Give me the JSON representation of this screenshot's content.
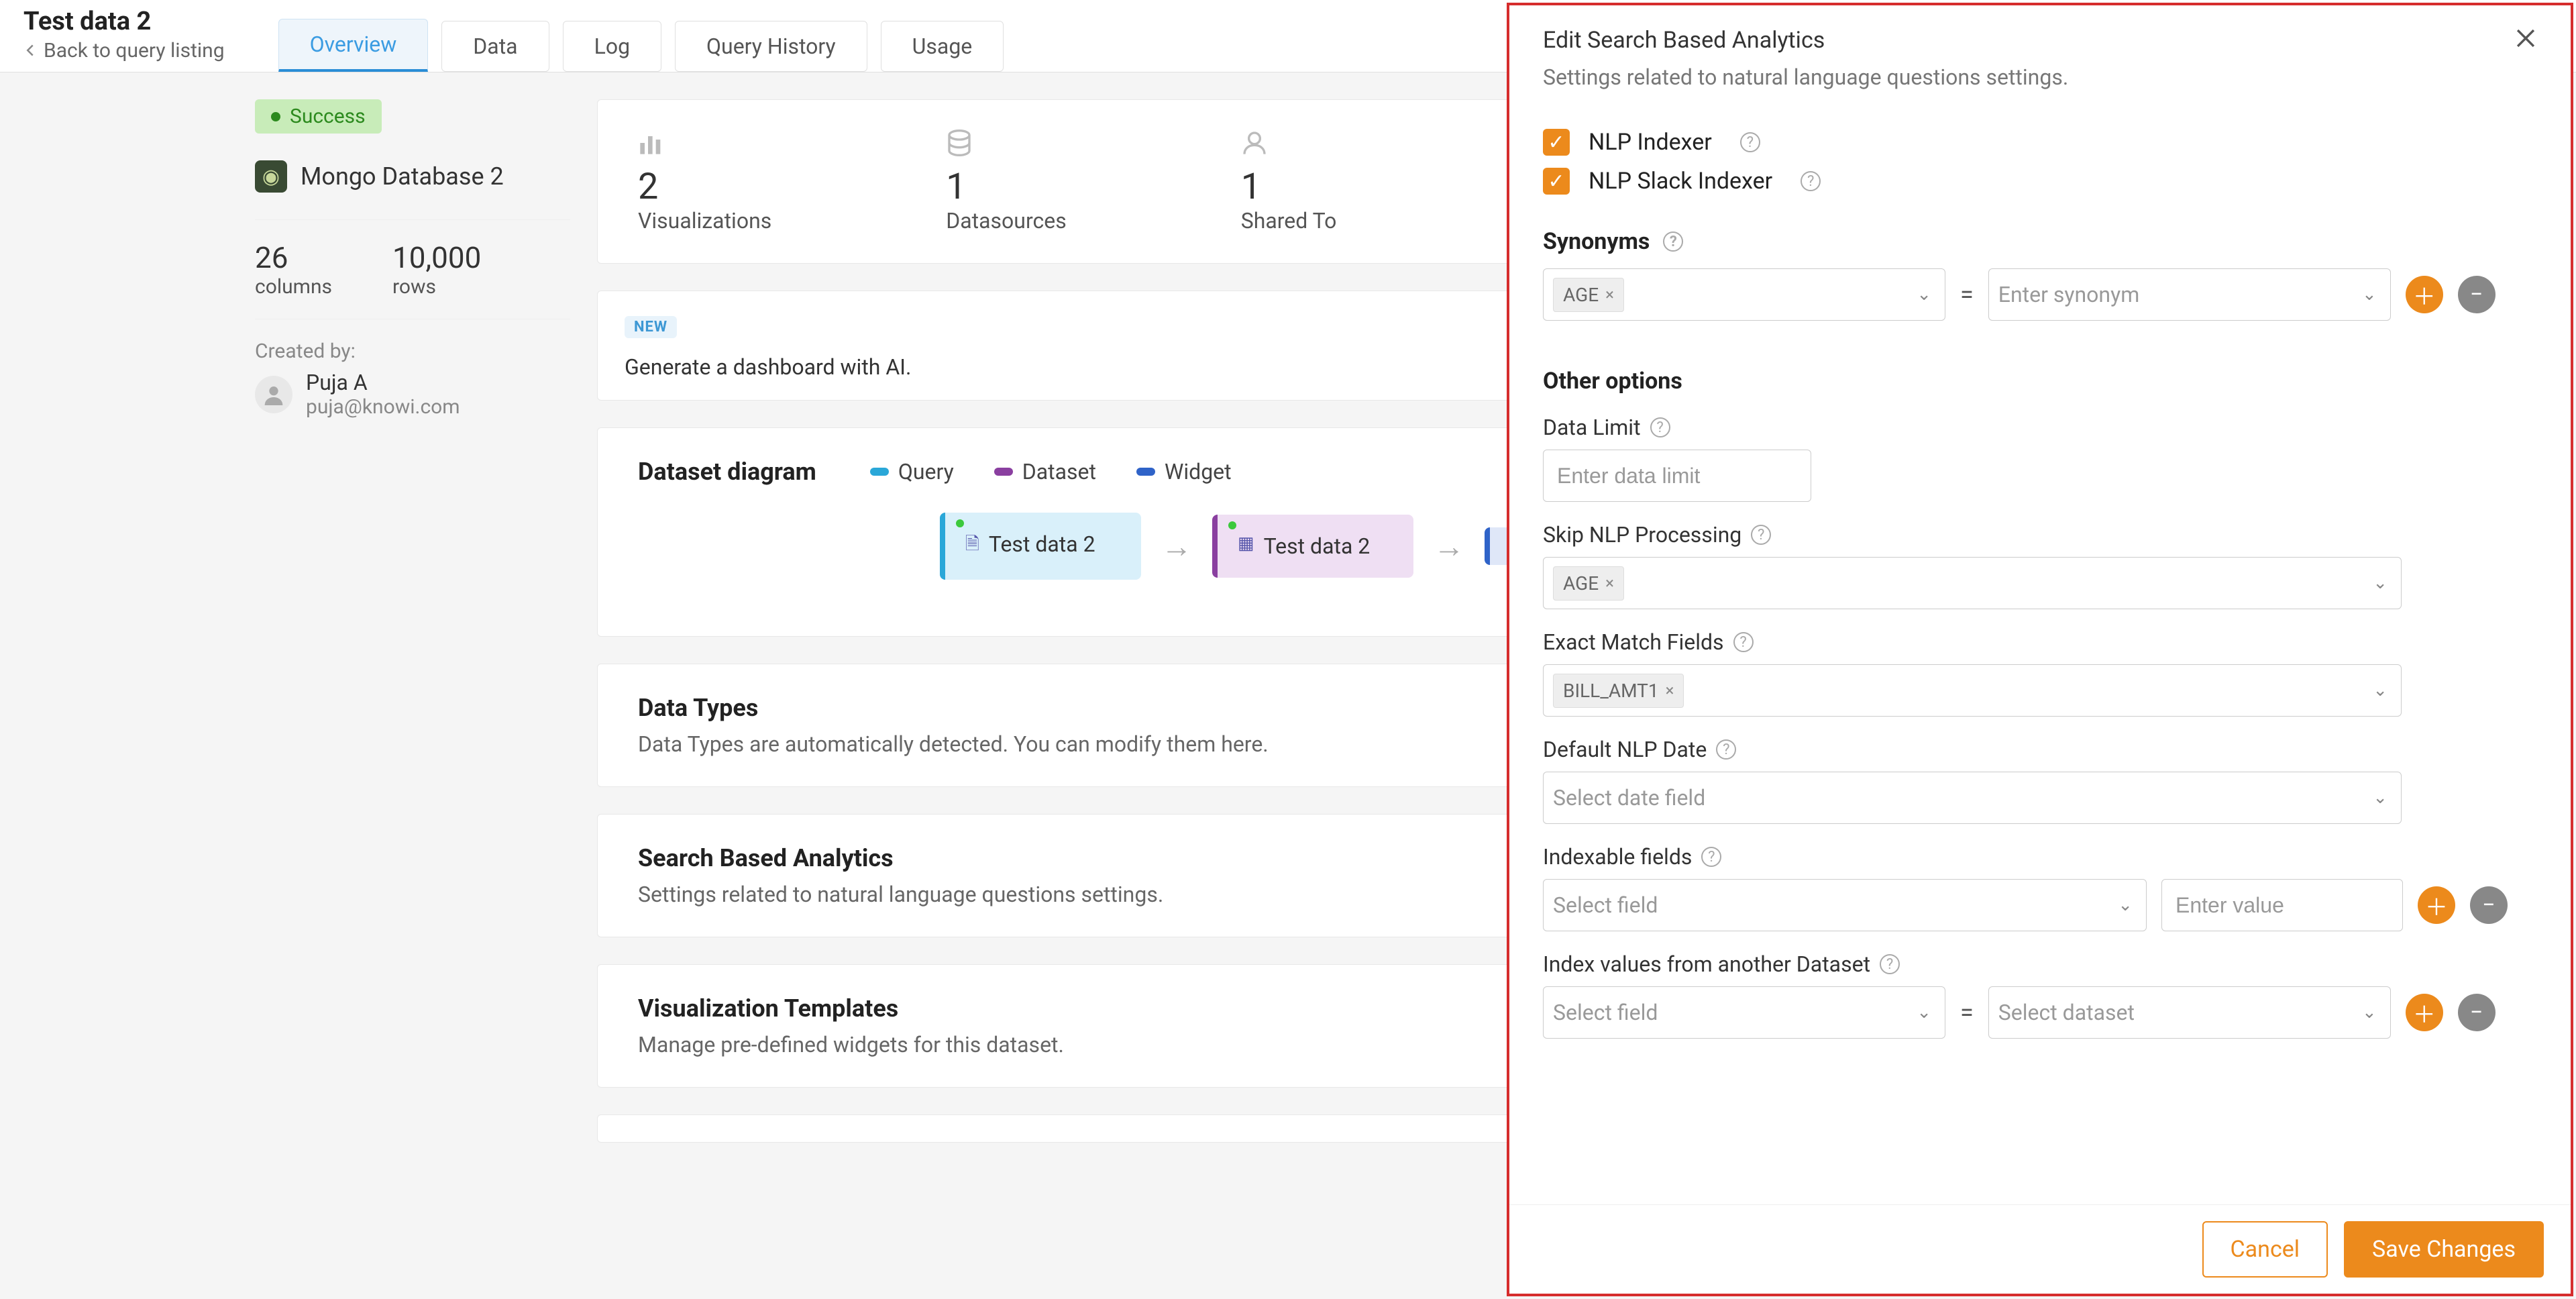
{
  "header": {
    "title": "Test data 2",
    "back_label": "Back to query listing",
    "tabs": [
      "Overview",
      "Data",
      "Log",
      "Query History",
      "Usage"
    ],
    "active_tab": 0
  },
  "left": {
    "status": "Success",
    "datasource_name": "Mongo Database 2",
    "cols_value": "26",
    "cols_label": "columns",
    "rows_value": "10,000",
    "rows_label": "rows",
    "created_by_label": "Created by:",
    "author_name": "Puja A",
    "author_email": "puja@knowi.com"
  },
  "stats": {
    "viz_value": "2",
    "viz_label": "Visualizations",
    "ds_value": "1",
    "ds_label": "Datasources",
    "shared_value": "1",
    "shared_label": "Shared To"
  },
  "gen_card": {
    "new_tag": "NEW",
    "text": "Generate a dashboard with AI."
  },
  "diagram": {
    "title": "Dataset diagram",
    "legend": {
      "query": "Query",
      "dataset": "Dataset",
      "widget": "Widget"
    },
    "node_query": "Test data 2",
    "node_dataset": "Test data 2"
  },
  "dtype_card": {
    "title": "Data Types",
    "sub": "Data Types are automatically detected. You can modify them here."
  },
  "sba_card": {
    "title": "Search Based Analytics",
    "sub": "Settings related to natural language questions settings."
  },
  "vt_card": {
    "title": "Visualization Templates",
    "sub": "Manage pre-defined widgets for this dataset."
  },
  "panel": {
    "title": "Edit Search Based Analytics",
    "subtitle": "Settings related to natural language questions settings.",
    "chk_nlp": "NLP Indexer",
    "chk_slack": "NLP Slack Indexer",
    "syn_header": "Synonyms",
    "syn_pill": "AGE",
    "syn_input_ph": "Enter synonym",
    "other_header": "Other options",
    "dlimit_label": "Data Limit",
    "dlimit_ph": "Enter data limit",
    "skip_label": "Skip NLP Processing",
    "skip_pill": "AGE",
    "exact_label": "Exact Match Fields",
    "exact_pill": "BILL_AMT1",
    "defdate_label": "Default NLP Date",
    "defdate_ph": "Select date field",
    "idx_label": "Indexable fields",
    "idx_sel_ph": "Select field",
    "idx_val_ph": "Enter value",
    "idxds_label": "Index values from another Dataset",
    "idxds_sel_ph": "Select field",
    "idxds_ds_ph": "Select dataset",
    "cancel": "Cancel",
    "save": "Save Changes"
  }
}
